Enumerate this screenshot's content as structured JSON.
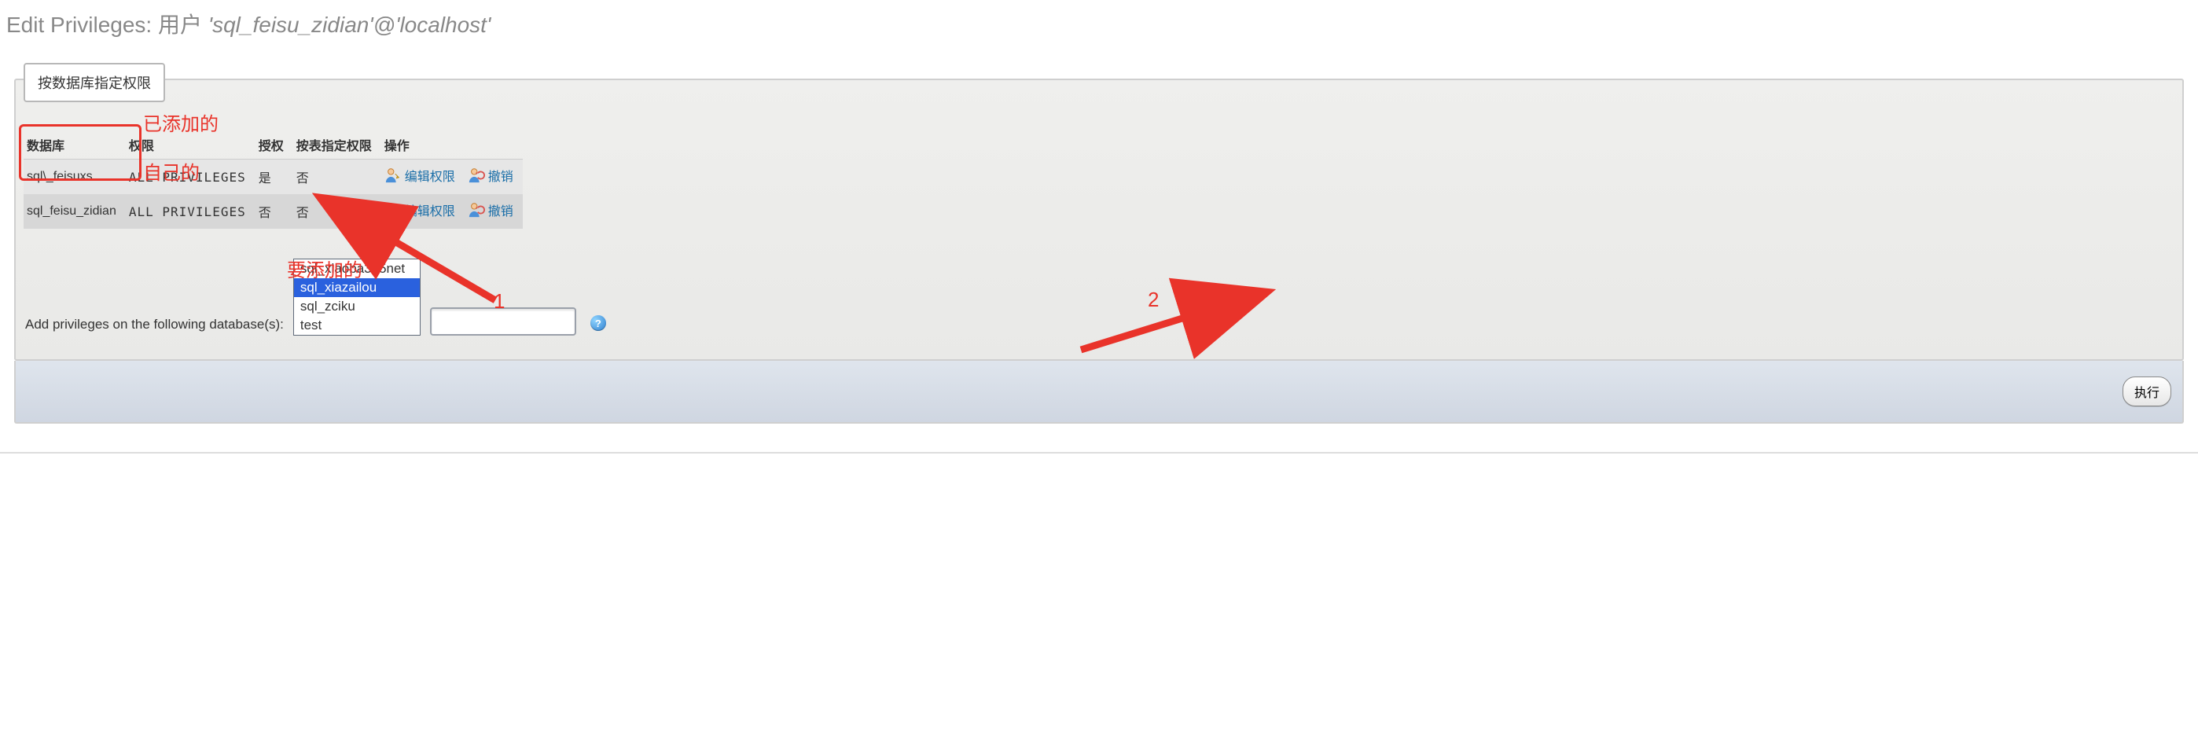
{
  "heading": {
    "prefix": "Edit Privileges: 用户 ",
    "user_host": "'sql_feisu_zidian'@'localhost'"
  },
  "legend": "按数据库指定权限",
  "table": {
    "columns": {
      "db": "数据库",
      "priv": "权限",
      "grant": "授权",
      "tblspec": "按表指定权限",
      "action": "操作"
    },
    "rows": [
      {
        "db": "sql\\_feisuxs",
        "priv": "ALL PRIVILEGES",
        "grant": "是",
        "tblspec": "否",
        "edit": "编辑权限",
        "revoke": "撤销"
      },
      {
        "db": "sql_feisu_zidian",
        "priv": "ALL PRIVILEGES",
        "grant": "否",
        "tblspec": "否",
        "edit": "编辑权限",
        "revoke": "撤销"
      }
    ]
  },
  "add": {
    "label": "Add privileges on the following database(s):",
    "options": [
      {
        "value": "sql_xiaoba365net",
        "selected": false
      },
      {
        "value": "sql_xiazailou",
        "selected": true
      },
      {
        "value": "sql_zciku",
        "selected": false
      },
      {
        "value": "test",
        "selected": false
      }
    ],
    "text_value": "",
    "help": "?"
  },
  "footer": {
    "submit": "执行"
  },
  "annot": {
    "added_label": "已添加的",
    "self_label": "自己的",
    "to_add_label": "要添加的",
    "num1": "1",
    "num2": "2"
  }
}
